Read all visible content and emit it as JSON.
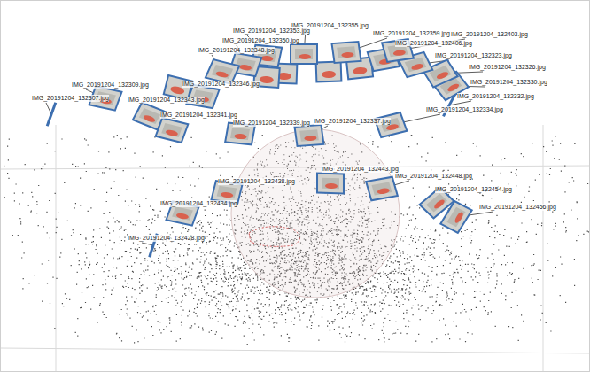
{
  "cameras": [
    {
      "label": "IMG_20191204_132307.jpg"
    },
    {
      "label": "IMG_20191204_132309.jpg"
    },
    {
      "label": "IMG_20191204_132343.jpg"
    },
    {
      "label": "IMG_20191204_132346.jpg"
    },
    {
      "label": "IMG_20191204_132341.jpg"
    },
    {
      "label": "IMG_20191204_132339.jpg"
    },
    {
      "label": "IMG_20191204_132337.jpg"
    },
    {
      "label": "IMG_20191204_132334.jpg"
    },
    {
      "label": "IMG_20191204_132332.jpg"
    },
    {
      "label": "IMG_20191204_132330.jpg"
    },
    {
      "label": "IMG_20191204_132326.jpg"
    },
    {
      "label": "IMG_20191204_132323.jpg"
    },
    {
      "label": "IMG_20191204_132406.jpg"
    },
    {
      "label": "IMG_20191204_132403.jpg"
    },
    {
      "label": "IMG_20191204_132355.jpg"
    },
    {
      "label": "IMG_20191204_132353.jpg"
    },
    {
      "label": "IMG_20191204_132350.jpg"
    },
    {
      "label": "IMG_20191204_132348.jpg"
    },
    {
      "label": "IMG_20191204_132443.jpg"
    },
    {
      "label": "IMG_20191204_132438.jpg"
    },
    {
      "label": "IMG_20191204_132434.jpg"
    },
    {
      "label": "IMG_20191204_132428.jpg"
    },
    {
      "label": "IMG_20191204_132448.jpg"
    },
    {
      "label": "IMG_20191204_132454.jpg"
    },
    {
      "label": "IMG_20191204_132456.jpg"
    },
    {
      "label": "IMG_20191204_132359.jpg"
    }
  ]
}
